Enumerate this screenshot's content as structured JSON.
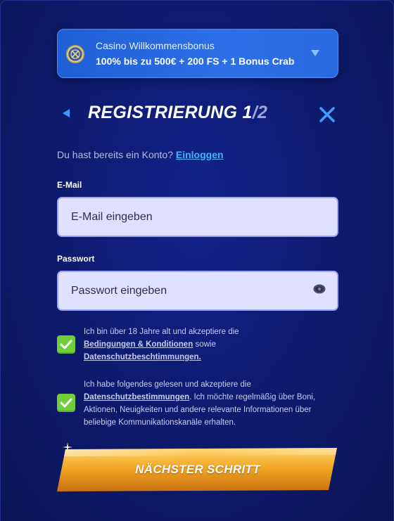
{
  "bonus": {
    "title": "Casino Willkommensbonus",
    "offer": "100% bis zu 500€ + 200 FS + 1 Bonus Crab",
    "icon": "coin-badge-icon"
  },
  "registration": {
    "title": "REGISTRIERUNG 1",
    "step_suffix": "/2"
  },
  "login": {
    "prompt": "Du hast bereits ein Konto?",
    "link": "Einloggen"
  },
  "form": {
    "email_label": "E-Mail",
    "email_placeholder": "E-Mail eingeben",
    "password_label": "Passwort",
    "password_placeholder": "Passwort eingeben"
  },
  "consents": [
    {
      "checked": true,
      "text_before": "Ich bin über 18 Jahre alt und akzeptiere die",
      "link1": "Bedingungen & Konditionen",
      "text_mid": "sowie",
      "link2": "Datenschutzbeschtimmungen."
    },
    {
      "checked": true,
      "text_before": "Ich habe folgendes gelesen und akzeptiere die",
      "link1": "Datenschutzbestimmungen",
      "text_after": ". Ich möchte regelmäßig über Boni, Aktionen, Neuigkeiten und andere relevante Informationen über beliebige Kommunikationskanäle erhalten."
    }
  ],
  "cta": {
    "label": "NÄCHSTER SCHRITT"
  },
  "colors": {
    "background": "#0d1b6e",
    "accent_blue": "#41b6ff",
    "checkbox_green": "#6fcf3b",
    "cta_gold": "#f2a826"
  }
}
